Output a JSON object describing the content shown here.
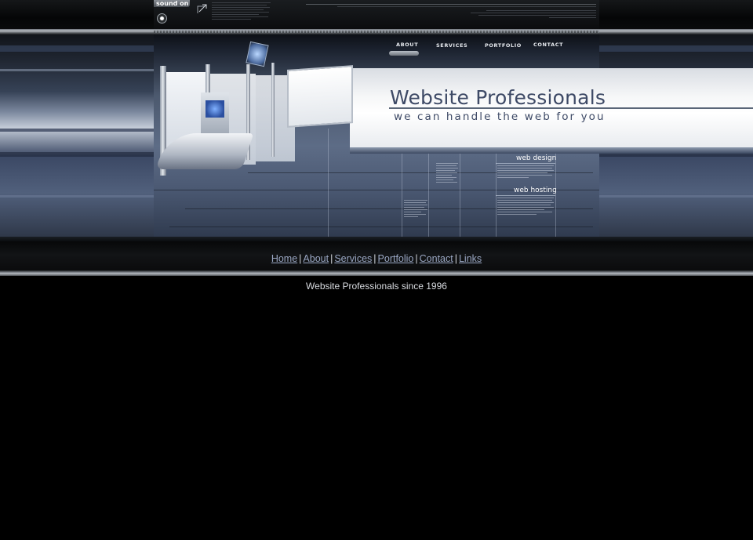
{
  "header": {
    "sound_label": "sound on"
  },
  "top_nav": {
    "items": [
      "ABOUT",
      "SERVICES",
      "PORTFOLIO",
      "CONTACT"
    ]
  },
  "banner": {
    "title": "Website Professionals",
    "tagline": "we can handle the web for you"
  },
  "services": {
    "web_design": "web design",
    "web_hosting": "web hosting"
  },
  "footer_nav": {
    "links": [
      "Home",
      "About",
      "Services",
      "Portfolio",
      "Contact",
      "Links"
    ],
    "separator": "|"
  },
  "copyright": "Website Professionals since 1996",
  "colors": {
    "title": "#3e4a66",
    "link": "#9aa7c3",
    "background": "#000000"
  }
}
